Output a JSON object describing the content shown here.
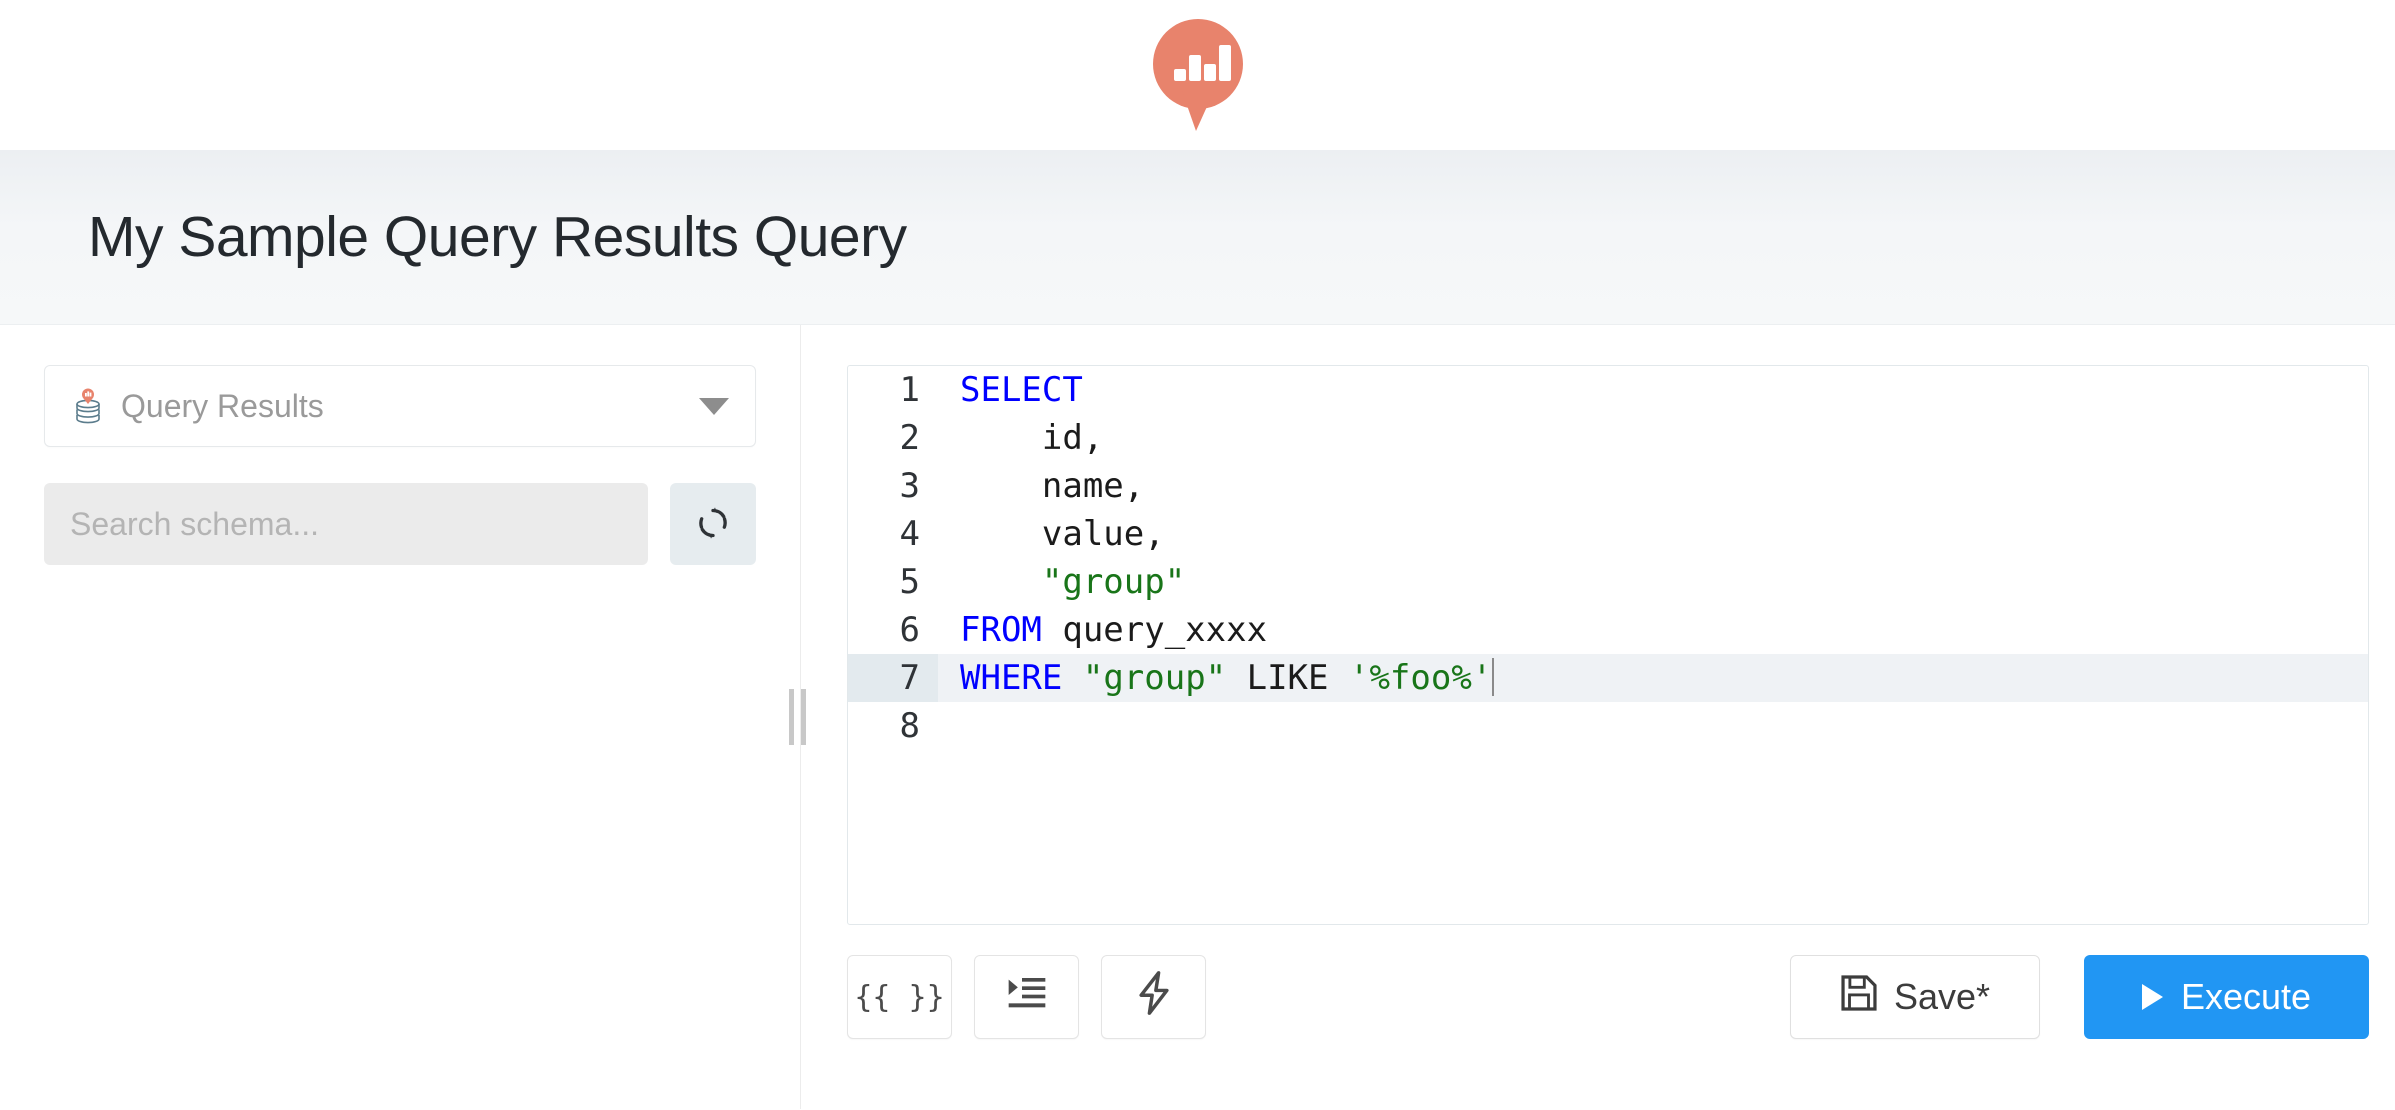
{
  "brand": {
    "logo_icon": "bar-chart-speech-bubble-logo",
    "logo_color": "#e8836c",
    "accent_color": "#2196f3"
  },
  "header": {
    "title": "My Sample Query Results Query"
  },
  "schema_panel": {
    "data_source": {
      "icon": "database-icon",
      "label": "Query Results",
      "caret_icon": "chevron-down-icon"
    },
    "search": {
      "placeholder": "Search schema...",
      "value": ""
    },
    "refresh": {
      "icon": "refresh-icon",
      "label": ""
    }
  },
  "editor": {
    "language": "sql",
    "active_line": 7,
    "cursor_line": 7,
    "lines": [
      {
        "n": "1",
        "tokens": [
          {
            "t": "SELECT",
            "c": "kw"
          }
        ]
      },
      {
        "n": "2",
        "tokens": [
          {
            "t": "    id,",
            "c": "plain"
          }
        ]
      },
      {
        "n": "3",
        "tokens": [
          {
            "t": "    name,",
            "c": "plain"
          }
        ]
      },
      {
        "n": "4",
        "tokens": [
          {
            "t": "    value,",
            "c": "plain"
          }
        ]
      },
      {
        "n": "5",
        "tokens": [
          {
            "t": "    ",
            "c": "plain"
          },
          {
            "t": "\"group\"",
            "c": "str"
          }
        ]
      },
      {
        "n": "6",
        "tokens": [
          {
            "t": "FROM",
            "c": "kw"
          },
          {
            "t": " query_xxxx",
            "c": "plain"
          }
        ]
      },
      {
        "n": "7",
        "tokens": [
          {
            "t": "WHERE",
            "c": "kw"
          },
          {
            "t": " ",
            "c": "plain"
          },
          {
            "t": "\"group\"",
            "c": "str"
          },
          {
            "t": " LIKE ",
            "c": "plain"
          },
          {
            "t": "'%foo%'",
            "c": "str"
          }
        ]
      },
      {
        "n": "8",
        "tokens": [
          {
            "t": "",
            "c": "plain"
          }
        ]
      }
    ],
    "plain_text": "SELECT\n    id,\n    name,\n    value,\n    \"group\"\nFROM query_xxxx\nWHERE \"group\" LIKE '%foo%'\n"
  },
  "toolbar": {
    "params_label": "{{ }}",
    "params_name": "query-parameters-button",
    "format_icon": "format-indent-icon",
    "autocomplete_icon": "lightning-bolt-icon",
    "save_label": "Save*",
    "save_icon": "floppy-disk-icon",
    "execute_label": "Execute",
    "execute_icon": "play-icon"
  }
}
